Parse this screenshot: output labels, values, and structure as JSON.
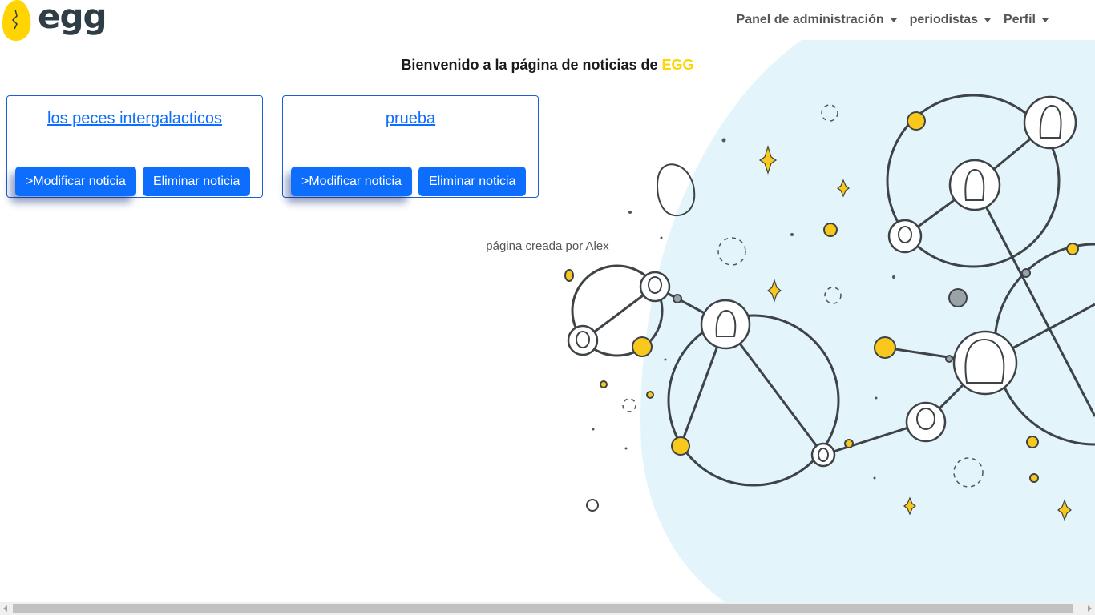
{
  "brand": {
    "logo_text": "egg"
  },
  "nav": {
    "items": [
      {
        "label": "Panel de administración"
      },
      {
        "label": "periodistas"
      },
      {
        "label": "Perfil"
      }
    ]
  },
  "welcome": {
    "prefix": "Bienvenido a la página de noticias de ",
    "brand": "EGG"
  },
  "cards": [
    {
      "title": "los peces intergalacticos",
      "edit_label": ">Modificar noticia",
      "delete_label": "Eliminar noticia"
    },
    {
      "title": "prueba",
      "edit_label": ">Modificar noticia",
      "delete_label": "Eliminar noticia"
    }
  ],
  "footer": {
    "text": "página creada por Alex"
  },
  "colors": {
    "primary": "#0d6efd",
    "brand_yellow": "#ffd400",
    "illustration_bg": "#e4f4fb",
    "node_yellow": "#f8c81c"
  }
}
